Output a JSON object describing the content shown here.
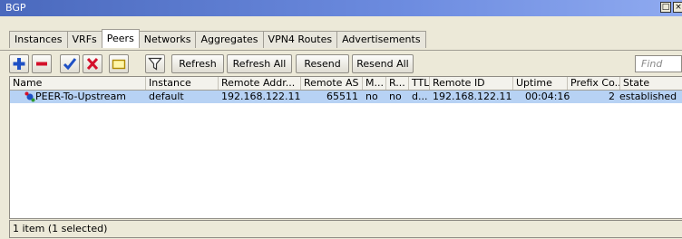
{
  "window": {
    "title": "BGP"
  },
  "tabs": [
    "Instances",
    "VRFs",
    "Peers",
    "Networks",
    "Aggregates",
    "VPN4 Routes",
    "Advertisements"
  ],
  "active_tab": "Peers",
  "toolbar": {
    "refresh_label": "Refresh",
    "refresh_all_label": "Refresh All",
    "resend_label": "Resend",
    "resend_all_label": "Resend All",
    "find_placeholder": "Find"
  },
  "table": {
    "columns": [
      "Name",
      "Instance",
      "Remote Addr...",
      "Remote AS",
      "M...",
      "R...",
      "TTL",
      "Remote ID",
      "Uptime",
      "Prefix Co...",
      "State"
    ],
    "rows": [
      {
        "name": "PEER-To-Upstream",
        "instance": "default",
        "remote_addr": "192.168.122.11",
        "remote_as": "65511",
        "m": "no",
        "r": "no",
        "ttl": "d...",
        "remote_id": "192.168.122.11",
        "uptime": "00:04:16",
        "prefix_count": "2",
        "state": "established"
      }
    ]
  },
  "status": {
    "text": "1 item (1 selected)"
  },
  "colors": {
    "selection": "#b7d2f4",
    "titlebar": "#4a69bd"
  }
}
